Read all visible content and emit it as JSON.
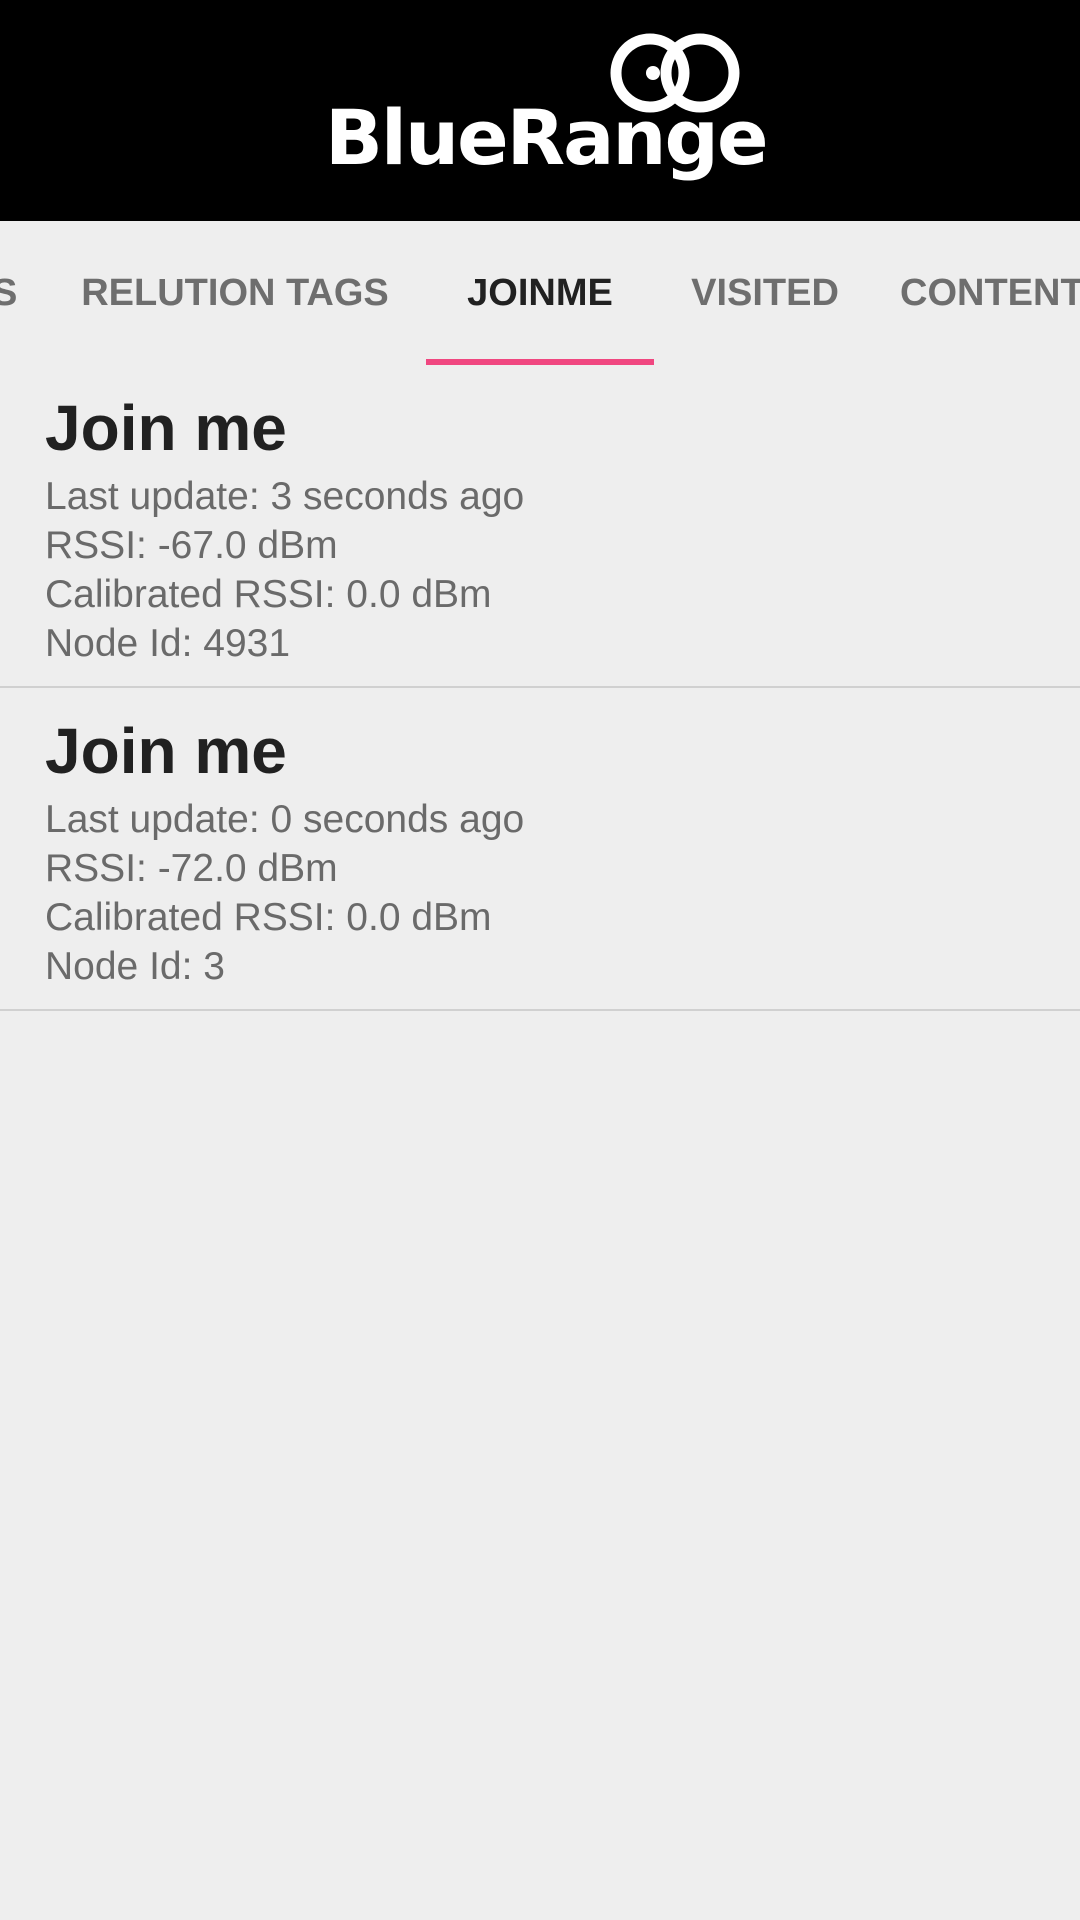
{
  "header": {
    "logo_text": "BlueRange",
    "logo_icon": "bluerange-logo-icon",
    "background_color": "#000000"
  },
  "tabs": [
    {
      "label": "S",
      "active": false
    },
    {
      "label": "RELUTION TAGS",
      "active": false
    },
    {
      "label": "JOINME",
      "active": true
    },
    {
      "label": "VISITED",
      "active": false
    },
    {
      "label": "CONTENT",
      "active": false
    }
  ],
  "accent_color": "#f04780",
  "items": [
    {
      "title": "Join me",
      "last_update": "Last update: 3 seconds ago",
      "rssi": "RSSI: -67.0 dBm",
      "calibrated_rssi": "Calibrated RSSI: 0.0 dBm",
      "node_id": "Node Id: 4931"
    },
    {
      "title": "Join me",
      "last_update": "Last update: 0 seconds ago",
      "rssi": "RSSI: -72.0 dBm",
      "calibrated_rssi": "Calibrated RSSI: 0.0 dBm",
      "node_id": "Node Id: 3"
    }
  ]
}
